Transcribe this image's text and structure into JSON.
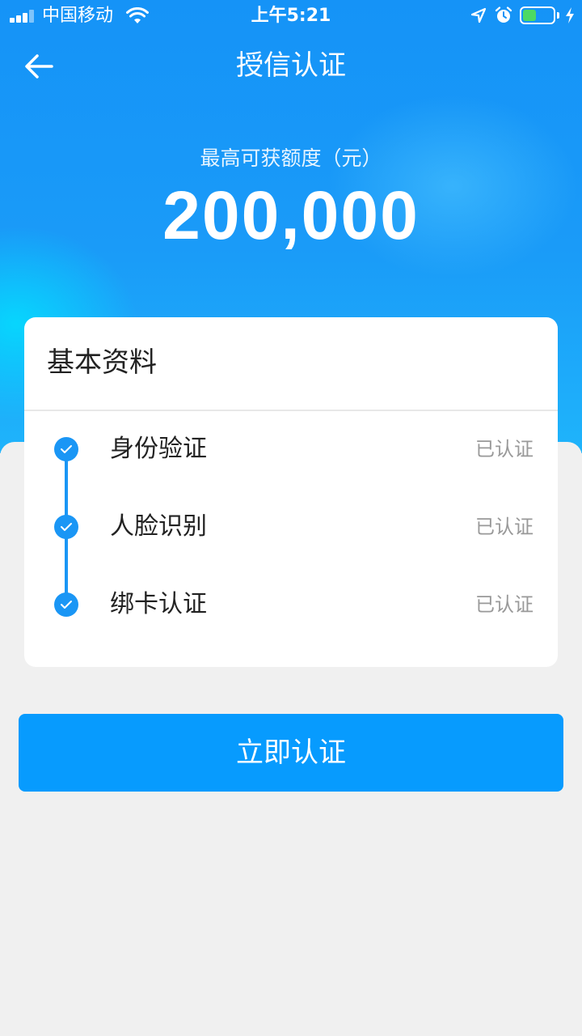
{
  "status_bar": {
    "carrier": "中国移动",
    "time": "上午5:21",
    "battery_level": 0.45,
    "battery_color": "#4cd964"
  },
  "nav": {
    "back_icon": "arrow-left-icon",
    "title": "授信认证"
  },
  "credit": {
    "label": "最高可获额度（元）",
    "amount": "200,000"
  },
  "card": {
    "title": "基本资料",
    "steps": [
      {
        "name": "身份验证",
        "status": "已认证",
        "icon": "check-circle-icon"
      },
      {
        "name": "人脸识别",
        "status": "已认证",
        "icon": "check-circle-icon"
      },
      {
        "name": "绑卡认证",
        "status": "已认证",
        "icon": "check-circle-icon"
      }
    ]
  },
  "action": {
    "label": "立即认证"
  },
  "colors": {
    "accent": "#079bfe",
    "timeline": "#1a96f5",
    "status_text": "#999999",
    "background": "#f0f0f0"
  }
}
